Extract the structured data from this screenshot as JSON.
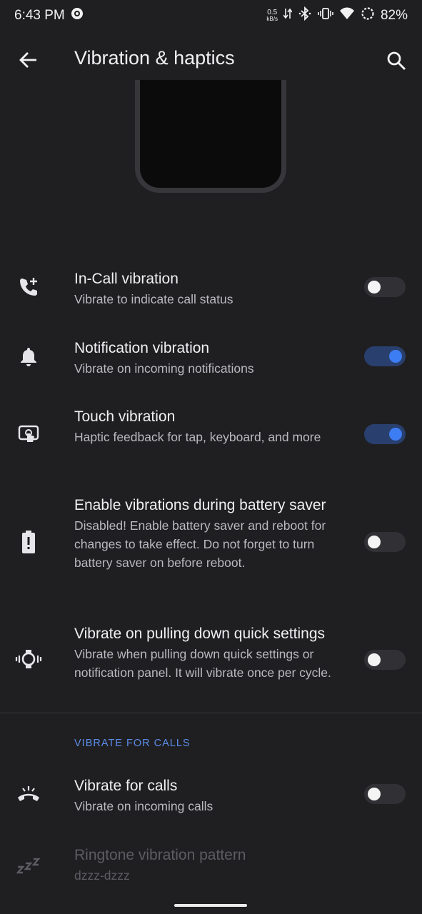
{
  "status": {
    "time": "6:43 PM",
    "net_speed_value": "0.5",
    "net_speed_unit": "kB/s",
    "battery": "82%"
  },
  "toolbar": {
    "title": "Vibration & haptics"
  },
  "settings": [
    {
      "title": "In-Call vibration",
      "subtitle": "Vibrate to indicate call status",
      "on": false,
      "icon": "phone-add-icon"
    },
    {
      "title": "Notification vibration",
      "subtitle": "Vibrate on incoming notifications",
      "on": true,
      "icon": "bell-icon"
    },
    {
      "title": "Touch vibration",
      "subtitle": "Haptic feedback for tap, keyboard, and more",
      "on": true,
      "icon": "touch-screen-icon"
    },
    {
      "title": "Enable vibrations during battery saver",
      "subtitle": "Disabled! Enable battery saver and reboot for changes to take effect. Do not forget to turn battery saver on before reboot.",
      "on": false,
      "icon": "battery-alert-icon"
    },
    {
      "title": "Vibrate on pulling down quick settings",
      "subtitle": "Vibrate when pulling down quick settings or notification panel. It will vibrate once per cycle.",
      "on": false,
      "icon": "watch-vibrate-icon"
    }
  ],
  "section": {
    "header": "VIBRATE FOR CALLS"
  },
  "calls": {
    "vibrate_for_calls": {
      "title": "Vibrate for calls",
      "subtitle": "Vibrate on incoming calls",
      "on": false,
      "icon": "ringing-phone-icon"
    },
    "ringtone_pattern": {
      "title": "Ringtone vibration pattern",
      "subtitle": "dzzz-dzzz",
      "icon": "zzz-icon"
    }
  },
  "colors": {
    "background": "#1f1f22",
    "accent": "#3d7df3",
    "section_header": "#5d8ce8"
  }
}
